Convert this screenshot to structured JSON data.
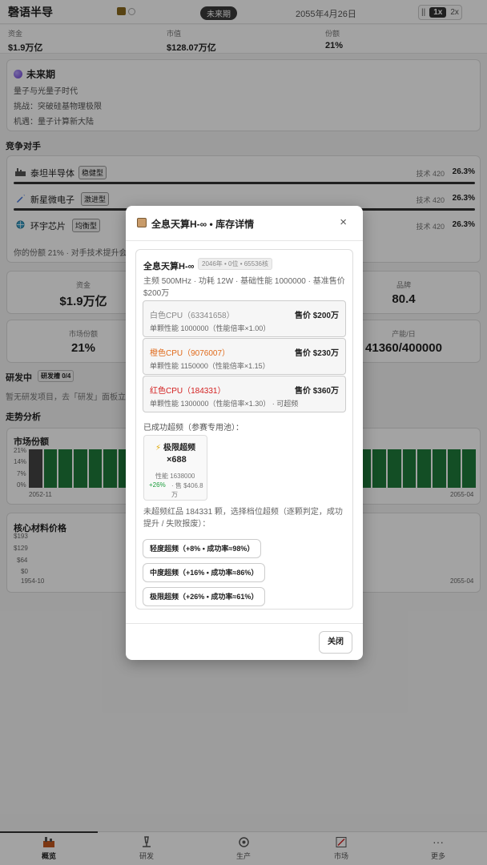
{
  "header": {
    "title": "磬语半导",
    "era_badge": "未来期",
    "date": "2055年4月26日",
    "speed": {
      "pause": "||",
      "x1": "1x",
      "x2": "2x"
    }
  },
  "stats": [
    {
      "label": "资金",
      "value": "$1.9万亿"
    },
    {
      "label": "市值",
      "value": "$128.07万亿"
    },
    {
      "label": "份额",
      "value": "21%"
    }
  ],
  "era": {
    "title": "未来期",
    "line1": "量子与光量子时代",
    "line2": "挑战：突破硅基物理极限",
    "line3": "机遇：量子计算新大陆"
  },
  "competitors": {
    "section_title": "竞争对手",
    "items": [
      {
        "name": "泰坦半导体",
        "tag": "稳健型",
        "tech": "技术 420",
        "share": "26.3%"
      },
      {
        "name": "新星微电子",
        "tag": "激进型",
        "tech": "技术 420",
        "share": "26.3%"
      },
      {
        "name": "环宇芯片",
        "tag": "均衡型",
        "tech": "技术 420",
        "share": "26.3%"
      }
    ],
    "note": "你的份额 21% · 对手技术提升会"
  },
  "kpis": {
    "funds": {
      "label": "资金",
      "value": "$1.9万亿"
    },
    "brand": {
      "label": "品牌",
      "value": "80.4"
    },
    "share": {
      "label": "市场份额",
      "value": "21%"
    },
    "output": {
      "label": "产能/日",
      "value": "41360/400000"
    }
  },
  "rd": {
    "title": "研发中",
    "slots": "研发槽 0/4",
    "note": "暂无研发项目，去「研发」面板立"
  },
  "trend": {
    "title": "走势分析",
    "market_share": {
      "title": "市场份额",
      "y_ticks": [
        "21%",
        "14%",
        "7%",
        "0%"
      ],
      "x_start": "2052-11",
      "x_end": "2055-04"
    },
    "materials": {
      "title": "核心材料价格",
      "y_ticks": [
        "$193",
        "$129",
        "$64",
        "$0"
      ],
      "x_start": "1954-10",
      "x_end": "2055-04"
    }
  },
  "chart_data": {
    "type": "bar",
    "title": "市场份额",
    "x_range": [
      "2052-11",
      "2055-04"
    ],
    "ylim": [
      0,
      21
    ],
    "y_ticks": [
      "0%",
      "7%",
      "14%",
      "21%"
    ],
    "values": [
      21,
      21,
      21,
      21,
      21,
      21,
      21,
      21,
      21,
      21,
      21,
      21,
      21,
      21,
      21,
      21,
      21,
      21,
      21,
      21,
      21,
      21,
      21,
      21,
      21,
      21,
      21,
      21,
      21,
      21
    ],
    "colors": {
      "first": "#444444",
      "rest": "#1e7a3a"
    }
  },
  "nav": [
    {
      "label": "概览",
      "icon": "factory-icon"
    },
    {
      "label": "研发",
      "icon": "microscope-icon"
    },
    {
      "label": "生产",
      "icon": "gear-icon"
    },
    {
      "label": "市场",
      "icon": "chart-icon"
    },
    {
      "label": "更多",
      "icon": "more-icon"
    }
  ],
  "modal": {
    "title": "全息天算H-∞ • 库存详情",
    "close_x": "×",
    "product_name": "全息天算H-∞",
    "product_badge": "2046年 • 0位 • 65536核",
    "spec": "主频 500MHz · 功耗 12W · 基础性能 1000000 · 基准售价 $200万",
    "grades": [
      {
        "name": "白色CPU（63341658）",
        "price": "售价 $200万",
        "sub": "单颗性能 1000000（性能倍率×1.00）",
        "color": "#888888"
      },
      {
        "name": "橙色CPU（9076007）",
        "price": "售价 $230万",
        "sub": "单颗性能 1150000（性能倍率×1.15）",
        "color": "#e06a1a"
      },
      {
        "name": "红色CPU（184331）",
        "price": "售价 $360万",
        "sub": "单颗性能 1300000（性能倍率×1.30） · 可超频",
        "color": "#d32020"
      }
    ],
    "oc_success_label": "已成功超频（参赛专用池）：",
    "oc_card": {
      "title": "极限超频",
      "count": "×688",
      "perf": "性能 1638000",
      "bonus": "+26%",
      "price": "· 售 $406.8万"
    },
    "oc_note": "未超频红品 184331 颗，选择档位超频（逐颗判定，成功提升 / 失败报废）：",
    "options": [
      "轻度超频（+8% • 成功率≈98%）",
      "中度超频（+16% • 成功率≈86%）",
      "极限超频（+26% • 成功率≈61%）"
    ],
    "close_button": "关闭"
  }
}
